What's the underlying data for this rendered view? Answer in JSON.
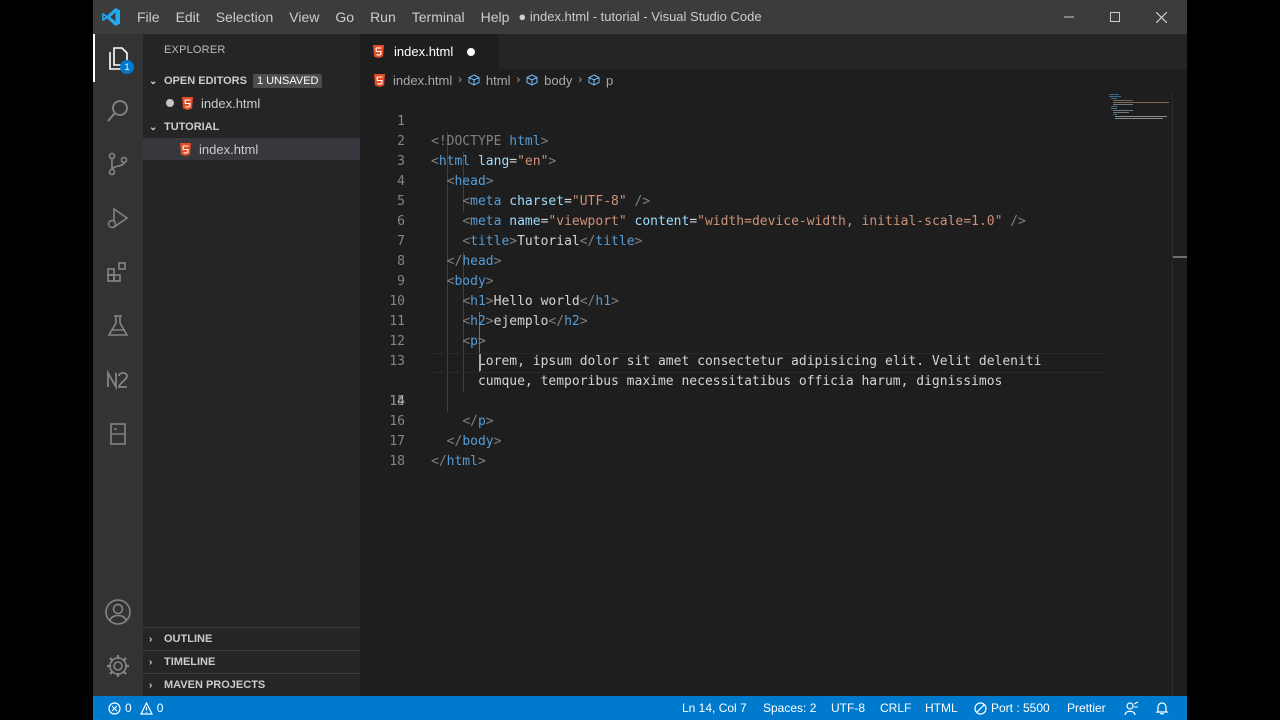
{
  "window": {
    "title": "● index.html - tutorial - Visual Studio Code",
    "menu": [
      "File",
      "Edit",
      "Selection",
      "View",
      "Go",
      "Run",
      "Terminal",
      "Help"
    ]
  },
  "activity_bar": {
    "items": [
      "explorer-icon",
      "search-icon",
      "source-control-icon",
      "run-debug-icon",
      "extensions-icon",
      "testing-icon",
      "n2-icon",
      "remote-explorer-icon"
    ],
    "explorer_badge": "1",
    "bottom": [
      "account-icon",
      "manage-gear-icon"
    ]
  },
  "sidebar": {
    "title": "EXPLORER",
    "open_editors": {
      "label": "OPEN EDITORS",
      "badge": "1 UNSAVED",
      "files": [
        "index.html"
      ]
    },
    "folder": {
      "label": "TUTORIAL",
      "files": [
        "index.html"
      ]
    },
    "outline": "OUTLINE",
    "timeline": "TIMELINE",
    "maven": "MAVEN PROJECTS"
  },
  "editor": {
    "tab": {
      "label": "index.html",
      "dirty": true
    },
    "breadcrumb": [
      "index.html",
      "html",
      "body",
      "p"
    ],
    "lines": [
      "1",
      "2",
      "3",
      "4",
      "5",
      "6",
      "7",
      "8",
      "9",
      "10",
      "11",
      "12",
      "13",
      "14",
      "15",
      "16",
      "17",
      "18"
    ],
    "code": {
      "l1_tag": "<!DOCTYPE",
      "l1_name": "html",
      "l1_close": ">",
      "l2_open": "<",
      "l2_tag": "html",
      "l2_attr": "lang",
      "l2_eq": "=",
      "l2_val": "\"en\"",
      "l2_close": ">",
      "head_open": "<",
      "head_tag": "head",
      "head_close": ">",
      "meta_tag": "meta",
      "meta_attr1": "charset",
      "meta_val1": "\"UTF-8\"",
      "meta_end": "/>",
      "meta2_attr1": "name",
      "meta2_val1": "\"viewport\"",
      "meta2_attr2": "content",
      "meta2_val2": "\"width=device-width, initial-scale=1.0\"",
      "title_tag": "title",
      "title_text": "Tutorial",
      "endhead_open": "</",
      "body_tag": "body",
      "h1_tag": "h1",
      "h1_text": "Hello world",
      "h2_tag": "h2",
      "h2_text": "ejemplo",
      "p_tag": "p",
      "p_line1": "Lorem, ipsum dolor sit amet consectetur adipisicing elit. Velit deleniti",
      "p_line2": "cumque, temporibus maxime necessitatibus officia harum, dignissimos"
    },
    "current_line": "14"
  },
  "status_bar": {
    "errors": "0",
    "warnings": "0",
    "position": "Ln 14, Col 7",
    "spaces": "Spaces: 2",
    "encoding": "UTF-8",
    "eol": "CRLF",
    "language": "HTML",
    "port": "Port : 5500",
    "formatter": "Prettier"
  },
  "colors": {
    "accent": "#007acc",
    "html_icon": "#e44d26",
    "tag": "#569cd6",
    "attribute": "#9cdcfe",
    "string": "#ce9178"
  }
}
